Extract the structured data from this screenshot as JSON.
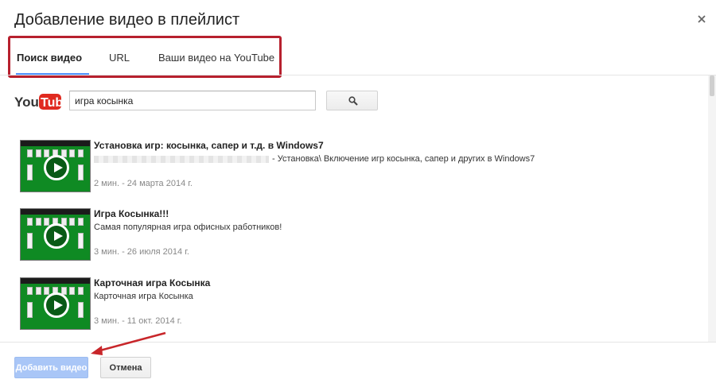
{
  "dialog": {
    "title": "Добавление видео в плейлист"
  },
  "tabs": [
    {
      "label": "Поиск видео",
      "active": true
    },
    {
      "label": "URL",
      "active": false
    },
    {
      "label": "Ваши видео на YouTube",
      "active": false
    }
  ],
  "search": {
    "logo_text": "YouTube",
    "query": "игра косынка"
  },
  "results": [
    {
      "title": "Установка игр: косынка, сапер и т.д. в Windows7",
      "description": "- Установка\\ Включение игр косынка, сапер и других в Windows7",
      "meta": "2 мин. - 24 марта 2014 г."
    },
    {
      "title": "Игра Косынка!!!",
      "description": "Самая популярная игра офисных работников!",
      "meta": "3 мин. - 26 июля 2014 г."
    },
    {
      "title": "Карточная игра Косынка",
      "description": "Карточная игра Косынка",
      "meta": "3 мин. - 11 окт. 2014 г."
    }
  ],
  "footer": {
    "add_label": "Добавить видео",
    "cancel_label": "Отмена"
  },
  "colors": {
    "highlight_box": "#b7202e",
    "active_tab_underline": "#4d90fe",
    "add_button_disabled": "#a9c6f7",
    "thumbnail_green": "#0f8a23"
  },
  "icons": [
    "close-icon",
    "youtube-logo",
    "search-icon",
    "play-icon",
    "arrow-annotation"
  ]
}
